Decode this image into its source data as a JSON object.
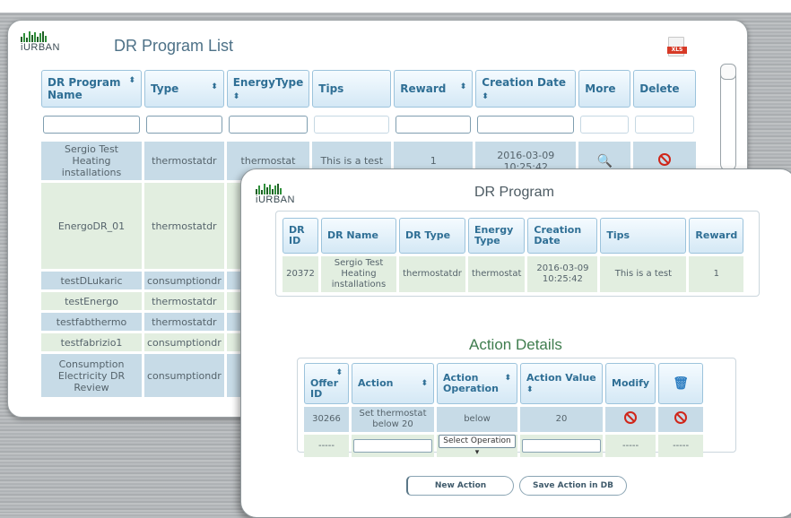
{
  "back": {
    "logo_text": "iURBAN",
    "title": "DR Program List",
    "xls_label": "XLS",
    "columns": [
      "DR Program Name",
      "Type",
      "EnergyType",
      "Tips",
      "Reward",
      "Creation Date",
      "More",
      "Delete"
    ],
    "rows": [
      {
        "name": "Sergio Test Heating installations",
        "type": "thermostatdr",
        "energy": "thermostat",
        "tips": "This is a test",
        "reward": "1",
        "date": "2016-03-09 10:25:42"
      },
      {
        "name": "EnergoDR_01",
        "type": "thermostatdr"
      },
      {
        "name": "testDLukaric",
        "type": "consumptiondr"
      },
      {
        "name": "testEnergo",
        "type": "thermostatdr"
      },
      {
        "name": "testfabthermo",
        "type": "thermostatdr"
      },
      {
        "name": "testfabrizio1",
        "type": "consumptiondr"
      },
      {
        "name": "Consumption Electricity DR Review",
        "type": "consumptiondr"
      }
    ]
  },
  "front": {
    "logo_text": "iURBAN",
    "title": "DR Program",
    "columns": [
      "DR ID",
      "DR Name",
      "DR Type",
      "Energy Type",
      "Creation Date",
      "Tips",
      "Reward"
    ],
    "row": {
      "id": "20372",
      "name": "Sergio Test Heating installations",
      "type": "thermostatdr",
      "energy": "thermostat",
      "date": "2016-03-09 10:25:42",
      "tips": "This is a test",
      "reward": "1"
    },
    "action_title": "Action Details",
    "action_columns": [
      "Offer ID",
      "Action",
      "Action Operation",
      "Action Value",
      "Modify"
    ],
    "action_row": {
      "offer_id": "30266",
      "action": "Set thermostat below 20",
      "operation": "below",
      "value": "20"
    },
    "placeholder_dash": "-----",
    "select_label": "Select Operation",
    "new_action": "New Action",
    "save_action": "Save Action in DB"
  }
}
